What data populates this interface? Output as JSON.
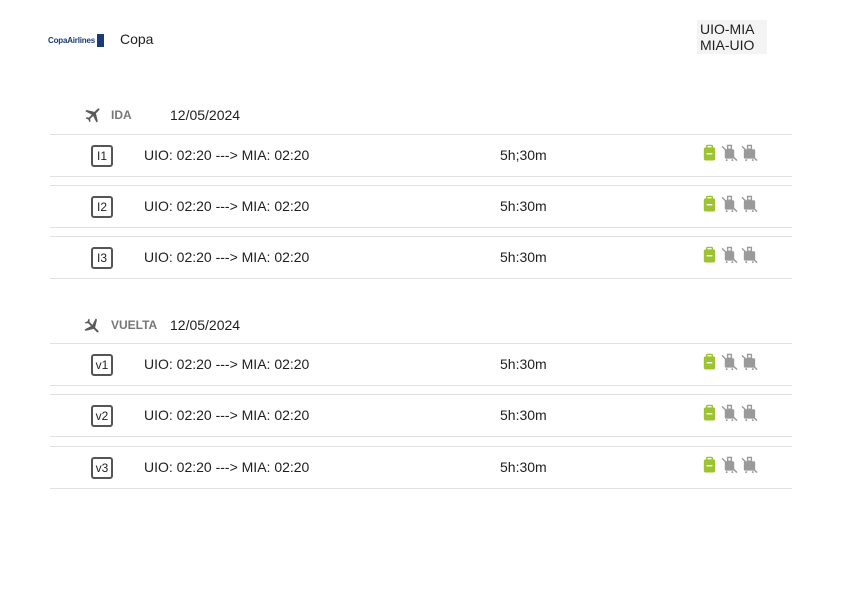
{
  "header": {
    "logo_text": "CopaAirlines",
    "airline_name": "Copa",
    "routes": [
      "UIO-MIA",
      "MIA-UIO"
    ]
  },
  "sections": [
    {
      "label": "IDA",
      "date": "12/05/2024",
      "icon": "airplane-departure-icon",
      "flights": [
        {
          "code": "I1",
          "route": "UIO: 02:20 ---> MIA: 02:20",
          "duration": "5h;30m"
        },
        {
          "code": "I2",
          "route": "UIO: 02:20 ---> MIA: 02:20",
          "duration": "5h:30m"
        },
        {
          "code": "I3",
          "route": "UIO: 02:20 ---> MIA: 02:20",
          "duration": "5h:30m"
        }
      ]
    },
    {
      "label": "VUELTA",
      "date": "12/05/2024",
      "icon": "airplane-return-icon",
      "flights": [
        {
          "code": "v1",
          "route": "UIO: 02:20 ---> MIA: 02:20",
          "duration": "5h:30m"
        },
        {
          "code": "v2",
          "route": "UIO: 02:20 ---> MIA: 02:20",
          "duration": "5h:30m"
        },
        {
          "code": "v3",
          "route": "UIO: 02:20 ---> MIA: 02:20",
          "duration": "5h:30m"
        }
      ]
    }
  ],
  "baggage": {
    "personal_item": {
      "icon": "backpack-icon",
      "included": true,
      "color": "#9dc232"
    },
    "carry_on": {
      "icon": "carry-on-bag-icon",
      "included": false,
      "color": "#9a9a9a"
    },
    "checked": {
      "icon": "checked-bag-icon",
      "included": false,
      "color": "#9a9a9a"
    }
  }
}
